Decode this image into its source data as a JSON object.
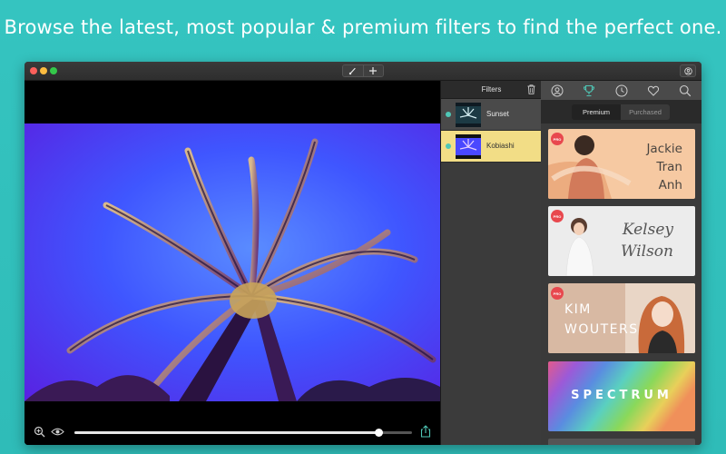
{
  "headline": "Browse the latest, most popular & premium filters to find the perfect one.",
  "toolbar": {
    "brush_icon": "brush-icon",
    "add_icon": "plus-icon",
    "account_icon": "account-icon"
  },
  "image_toolbar": {
    "zoom_icon": "zoom-in-icon",
    "eye_icon": "eye-icon",
    "slider_value": 0.9,
    "share_icon": "share-icon"
  },
  "filters": {
    "title": "Filters",
    "items": [
      {
        "label": "Sunset",
        "selected": false
      },
      {
        "label": "Kobiashi",
        "selected": true
      }
    ]
  },
  "store": {
    "icons": [
      "featured-icon",
      "trophy-icon",
      "clock-icon",
      "heart-icon",
      "search-icon"
    ],
    "segments": {
      "premium": "Premium",
      "purchased": "Purchased"
    },
    "cards": [
      {
        "badge": "PRO",
        "line1": "Jackie",
        "line2": "Tran",
        "line3": "Anh"
      },
      {
        "badge": "PRO",
        "line1": "Kelsey",
        "line2": "Wilson"
      },
      {
        "badge": "PRO",
        "line1": "KIM",
        "line2": "WOUTERS"
      },
      {
        "title": "SPECTRUM"
      }
    ]
  },
  "colors": {
    "background": "#33c1bd",
    "accent_teal": "#4fc7b6",
    "selected_row": "#f2dd86",
    "pro_badge": "#e8484e"
  }
}
